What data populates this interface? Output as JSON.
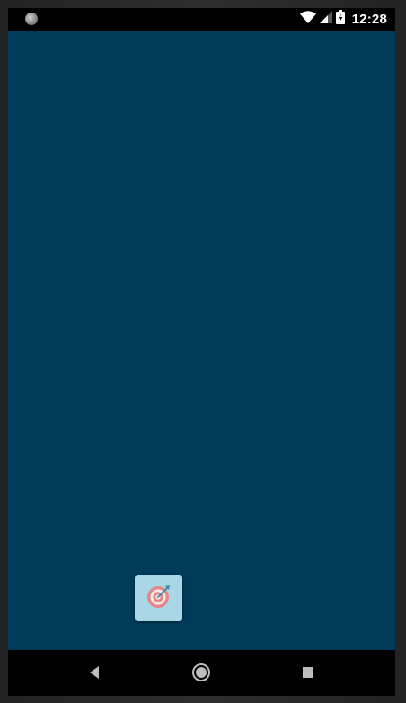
{
  "status_bar": {
    "time": "12:28",
    "icons": [
      "notification-dot-icon",
      "wifi-icon",
      "cell-signal-icon",
      "battery-charging-icon"
    ]
  },
  "app": {
    "background_color": "#013b5a",
    "target_button": {
      "icon": "target-icon",
      "background_color": "#a9d7e6"
    }
  },
  "nav_bar": {
    "buttons": [
      "back-icon",
      "home-icon",
      "recents-icon"
    ]
  }
}
